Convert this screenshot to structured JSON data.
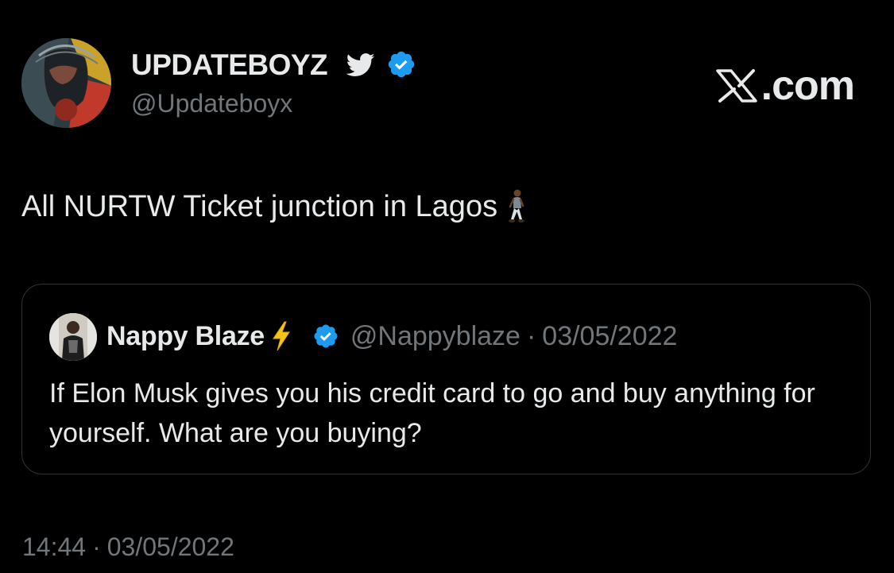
{
  "author": {
    "display_name": "UPDATEBOYZ",
    "handle": "@Updateboyx",
    "avatar_icon": "avatar-portrait",
    "badges": [
      "bird-icon",
      "verified-badge-icon"
    ]
  },
  "brand": {
    "text": ".com",
    "logo_icon": "x-logo-icon"
  },
  "tweet": {
    "text": "All NURTW Ticket junction in Lagos",
    "emoji_icon": "person-walking-icon"
  },
  "quote": {
    "author_name": "Nappy Blaze",
    "name_emoji_icon": "lightning-bolt-icon",
    "handle": "@Nappyblaze",
    "separator": "·",
    "date": "03/05/2022",
    "text": "If Elon Musk gives you his credit card to go and buy anything for yourself. What are you buying?"
  },
  "footer": {
    "time": "14:44",
    "separator": "·",
    "date": "03/05/2022"
  },
  "colors": {
    "background": "#000000",
    "primary_text": "#e7e9ea",
    "secondary_text": "#71767b",
    "border": "#2f3336",
    "verified_blue": "#1d9bf0",
    "bolt_yellow": "#f7c21a"
  }
}
